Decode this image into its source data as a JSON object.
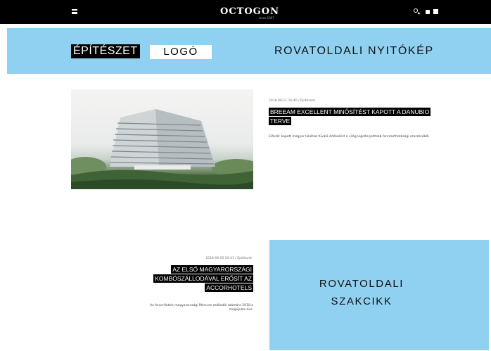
{
  "header": {
    "logo": "OCTOGON",
    "logo_sub": "since 1997",
    "icons": [
      "menu-icon",
      "search-icon",
      "bag-icon",
      "user-icon"
    ]
  },
  "banner": {
    "category": "ÉPÍTÉSZET",
    "logo_label": "LOGÓ",
    "title": "ROVATOLDALI NYITÓKÉP",
    "color": "#90d1f1"
  },
  "articles": [
    {
      "meta": "2018-06-11 16:40 / Építészet",
      "title": "BREEAM EXCELLENT MINŐSÍTÉST KAPOTT A DANUBIO TERVE",
      "excerpt": "Először kapott magyar lakóház Kiváló értékelést a világ legelterjedtebb fenntarthatósági szerzéséből."
    },
    {
      "meta": "2018-06-05 20:41 / Építészet",
      "title": "AZ ELSŐ MAGYARORSZÁGI KOMBÓSZÁLLODÁVAL ERŐSÍT AZ ACCORHOTELS",
      "excerpt": "Az AccorHotels magyarországi Mercure szállodái számára 2018 a megújulás éve."
    }
  ],
  "promo": {
    "text": "ROVATOLDALI\nSZAKCIKK",
    "color": "#90d1f1"
  }
}
